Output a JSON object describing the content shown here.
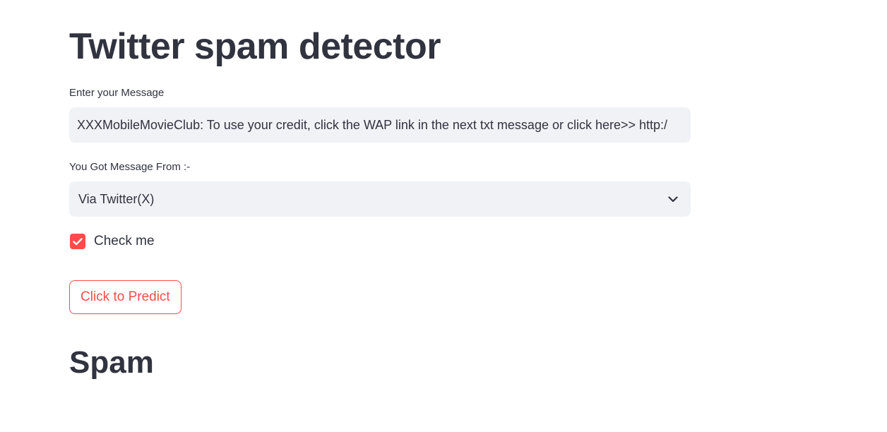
{
  "page": {
    "title": "Twitter spam detector"
  },
  "message_field": {
    "label": "Enter your Message",
    "value": "XXXMobileMovieClub: To use your credit, click the WAP link in the next txt message or click here>> http:/"
  },
  "source_select": {
    "label": "You Got Message From :-",
    "selected": "Via Twitter(X)",
    "icon": "chevron-down-icon"
  },
  "checkbox": {
    "label": "Check me",
    "checked": true,
    "icon": "checkmark-icon"
  },
  "predict_button": {
    "label": "Click to Predict"
  },
  "result": {
    "text": "Spam"
  },
  "colors": {
    "accent": "#ff4b4b",
    "text": "#31333f",
    "input_bg": "#f0f2f6"
  }
}
